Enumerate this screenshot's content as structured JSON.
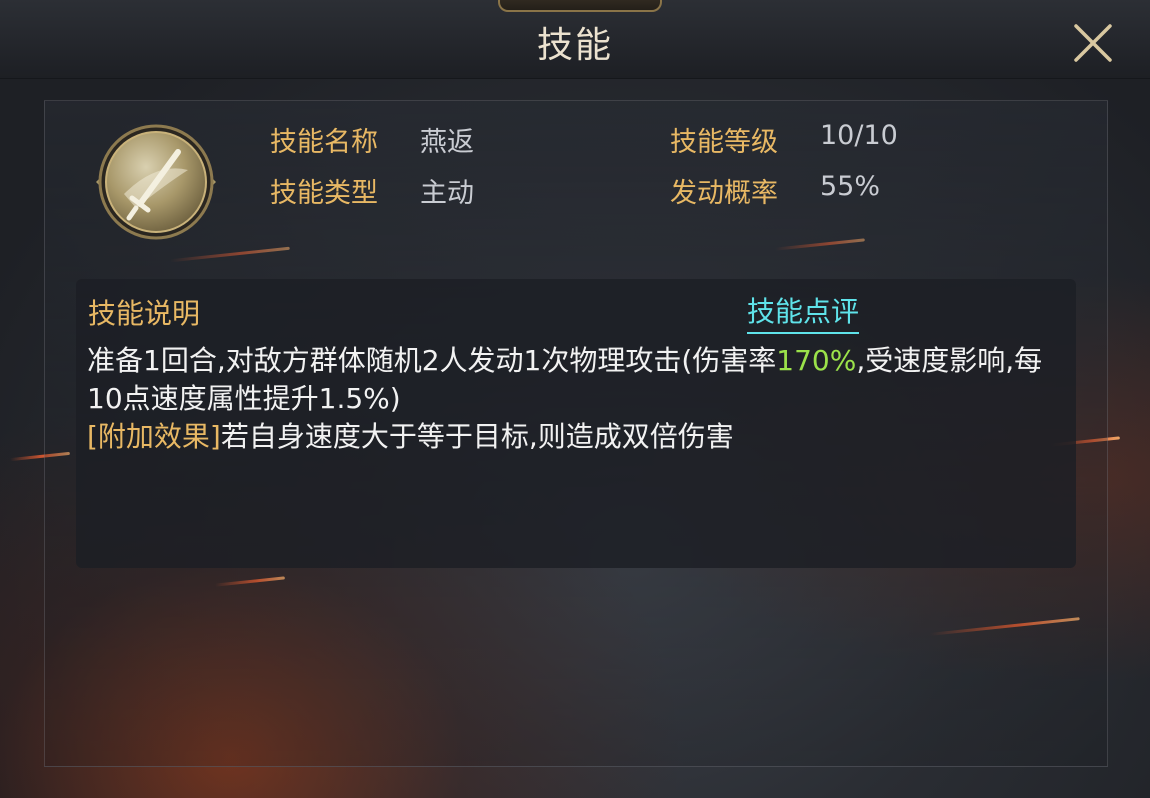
{
  "header": {
    "title": "技能"
  },
  "skill": {
    "icon": "sword-icon",
    "name_label": "技能名称",
    "name_value": "燕返",
    "type_label": "技能类型",
    "type_value": "主动",
    "level_label": "技能等级",
    "level_value": "10/10",
    "prob_label": "发动概率",
    "prob_value": "55%"
  },
  "description": {
    "title": "技能说明",
    "review_link": "技能点评",
    "line1_pre": "准备1回合,对敌方群体随机2人发动1次物理攻击(伤害率",
    "line1_highlight": "170%",
    "line1_post": ",受速度影响,每10点速度属性提升1.5%)",
    "extra_tag": "[附加效果]",
    "extra_text": "若自身速度大于等于目标,则造成双倍伤害"
  },
  "colors": {
    "label_gold": "#e8b864",
    "highlight_green": "#9be24a",
    "link_cyan": "#5fe3ea"
  }
}
